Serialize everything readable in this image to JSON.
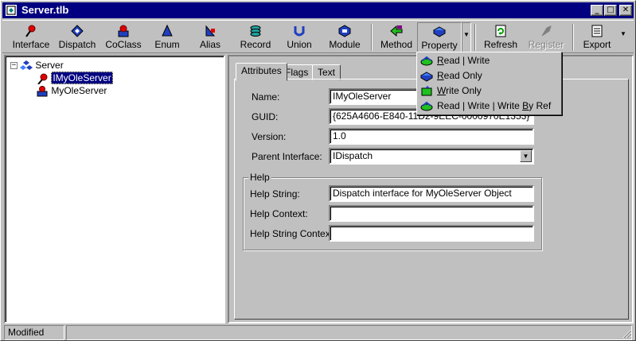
{
  "window": {
    "title": "Server.tlb",
    "min_glyph": "_",
    "max_glyph": "□",
    "close_glyph": "✕"
  },
  "toolbar": {
    "buttons": [
      {
        "label": "Interface",
        "icon": "pin-icon"
      },
      {
        "label": "Dispatch",
        "icon": "dispatch-icon"
      },
      {
        "label": "CoClass",
        "icon": "coclass-icon"
      },
      {
        "label": "Enum",
        "icon": "enum-icon"
      },
      {
        "label": "Alias",
        "icon": "alias-icon"
      },
      {
        "label": "Record",
        "icon": "record-icon"
      },
      {
        "label": "Union",
        "icon": "union-icon"
      },
      {
        "label": "Module",
        "icon": "module-icon"
      },
      {
        "label": "Method",
        "icon": "method-icon"
      },
      {
        "label": "Property",
        "icon": "property-icon"
      },
      {
        "label": "Refresh",
        "icon": "refresh-icon"
      },
      {
        "label": "Register",
        "icon": "register-icon"
      },
      {
        "label": "Export",
        "icon": "export-icon"
      }
    ],
    "arrow_glyph": "▼"
  },
  "tree": {
    "root": {
      "label": "Server",
      "expander": "−"
    },
    "children": [
      {
        "label": "IMyOleServer",
        "selected": true
      },
      {
        "label": "MyOleServer",
        "selected": false
      }
    ]
  },
  "tabs": [
    {
      "label": "Attributes",
      "active": true
    },
    {
      "label": "Flags"
    },
    {
      "label": "Text"
    }
  ],
  "form": {
    "name": {
      "label": "Name:",
      "value": "IMyOleServer"
    },
    "guid": {
      "label": "GUID:",
      "value": "{625A4606-E840-11D2-9EEC-0000970E1353}"
    },
    "version": {
      "label": "Version:",
      "value": "1.0"
    },
    "parent": {
      "label": "Parent Interface:",
      "value": "IDispatch"
    },
    "help": {
      "legend": "Help",
      "string": {
        "label": "Help String:",
        "value": "Dispatch interface for MyOleServer Object"
      },
      "context": {
        "label": "Help Context:",
        "value": ""
      },
      "string_context": {
        "label": "Help String Context:",
        "value": ""
      }
    }
  },
  "property_menu": [
    {
      "label": "Read | Write",
      "ul": "R",
      "rest": "ead | Write"
    },
    {
      "label": "Read Only",
      "ul": "R",
      "rest": "ead Only"
    },
    {
      "label": "Write Only",
      "ul": "W",
      "rest": "rite Only"
    },
    {
      "label": "Read | Write | Write By Ref",
      "pre": "Read | Write | Write ",
      "ul": "B",
      "rest": "y Ref"
    }
  ],
  "status": {
    "text": "Modified"
  }
}
